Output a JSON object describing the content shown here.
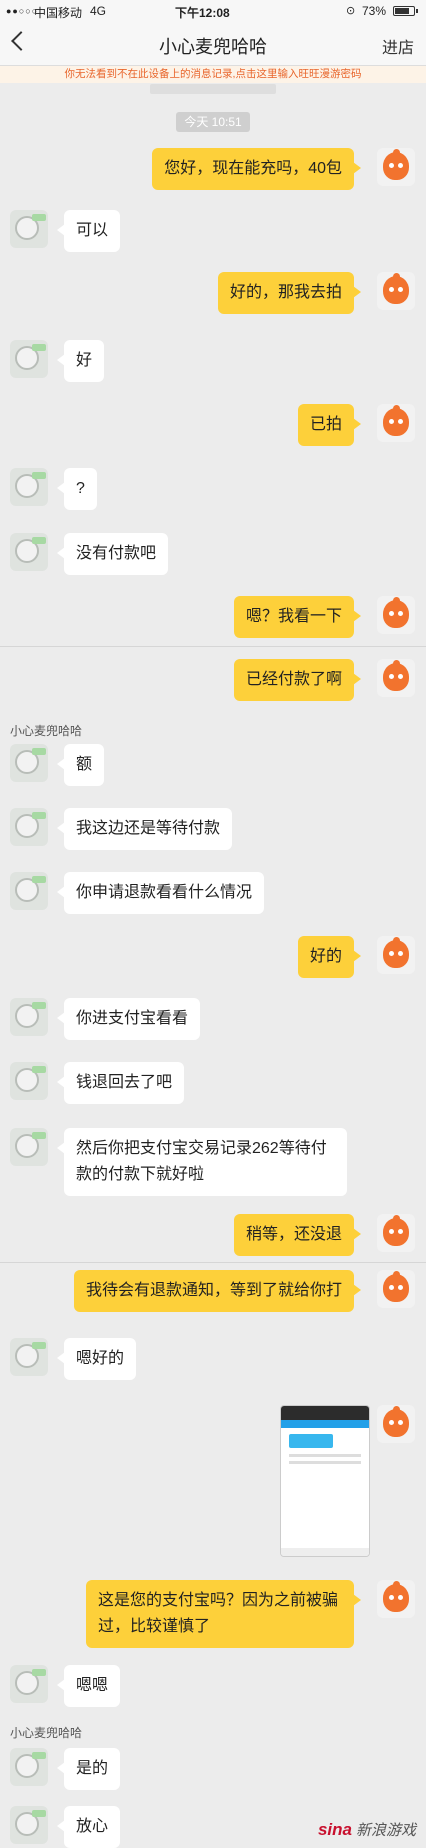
{
  "statusbar": {
    "signal": "●●○○○",
    "carrier": "中国移动",
    "network": "4G",
    "time": "下午12:08",
    "battery": "73%"
  },
  "header": {
    "title": "小心麦兜哈哈",
    "right_action": "进店"
  },
  "notice": "你无法看到不在此设备上的消息记录,点击这里输入旺旺漫游密码",
  "time_divider": "今天 10:51",
  "messages": [
    {
      "from": "self",
      "text": "您好，现在能充吗，40包"
    },
    {
      "from": "other",
      "text": "可以"
    },
    {
      "from": "self",
      "text": "好的，那我去拍"
    },
    {
      "from": "other",
      "text": "好"
    },
    {
      "from": "self",
      "text": "已拍"
    },
    {
      "from": "other",
      "text": "?"
    },
    {
      "from": "other",
      "text": "没有付款吧"
    },
    {
      "from": "self",
      "text": "嗯？我看一下"
    },
    {
      "from": "self",
      "text": "已经付款了啊"
    },
    {
      "from": "other",
      "text": "额"
    },
    {
      "from": "other",
      "text": "我这边还是等待付款"
    },
    {
      "from": "other",
      "text": "你申请退款看看什么情况"
    },
    {
      "from": "self",
      "text": "好的"
    },
    {
      "from": "other",
      "text": "你进支付宝看看"
    },
    {
      "from": "other",
      "text": "钱退回去了吧"
    },
    {
      "from": "other",
      "text": "然后你把支付宝交易记录262等待付款的付款下就好啦"
    },
    {
      "from": "self",
      "text": "稍等，还没退"
    },
    {
      "from": "self",
      "text": "我待会有退款通知，等到了就给你打"
    },
    {
      "from": "other",
      "text": "嗯好的"
    },
    {
      "from": "self",
      "text": "这是您的支付宝吗？因为之前被骗过，比较谨慎了"
    },
    {
      "from": "other",
      "text": "嗯嗯"
    },
    {
      "from": "other",
      "text": "是的"
    },
    {
      "from": "other",
      "text": "放心"
    }
  ],
  "sender_name": "小心麦兜哈哈",
  "watermark": {
    "logo": "sina",
    "text": "新浪游戏"
  }
}
